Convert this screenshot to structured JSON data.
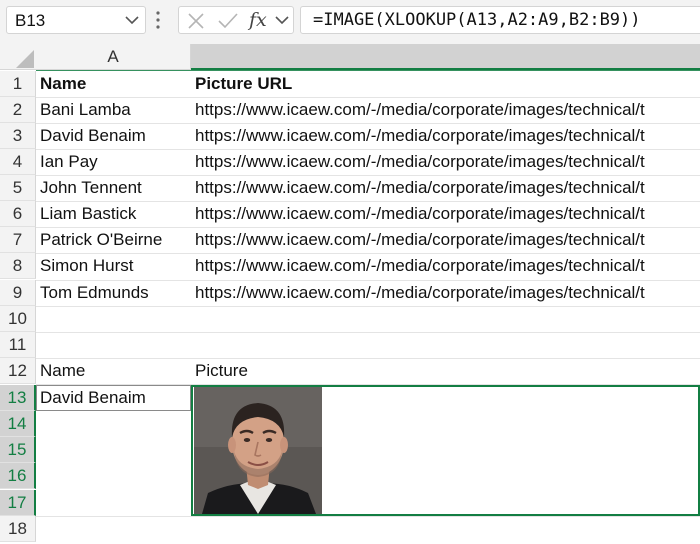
{
  "formula_bar": {
    "name_box": "B13",
    "fx_label": "fx",
    "formula": "=IMAGE(XLOOKUP(A13,A2:A9,B2:B9))"
  },
  "columns": [
    "A",
    ""
  ],
  "rows": [
    {
      "num": "1",
      "a": "Name",
      "b": "Picture URL"
    },
    {
      "num": "2",
      "a": "Bani Lamba",
      "b": "https://www.icaew.com/-/media/corporate/images/technical/t"
    },
    {
      "num": "3",
      "a": "David Benaim",
      "b": "https://www.icaew.com/-/media/corporate/images/technical/t"
    },
    {
      "num": "4",
      "a": "Ian Pay",
      "b": "https://www.icaew.com/-/media/corporate/images/technical/t"
    },
    {
      "num": "5",
      "a": "John Tennent",
      "b": "https://www.icaew.com/-/media/corporate/images/technical/t"
    },
    {
      "num": "6",
      "a": "Liam Bastick",
      "b": "https://www.icaew.com/-/media/corporate/images/technical/t"
    },
    {
      "num": "7",
      "a": "Patrick O'Beirne",
      "b": "https://www.icaew.com/-/media/corporate/images/technical/t"
    },
    {
      "num": "8",
      "a": "Simon Hurst",
      "b": "https://www.icaew.com/-/media/corporate/images/technical/t"
    },
    {
      "num": "9",
      "a": "Tom Edmunds",
      "b": "https://www.icaew.com/-/media/corporate/images/technical/t"
    },
    {
      "num": "10",
      "a": "",
      "b": ""
    },
    {
      "num": "11",
      "a": "",
      "b": ""
    },
    {
      "num": "12",
      "a": "Name",
      "b": "Picture"
    },
    {
      "num": "13",
      "a": "David Benaim",
      "b": ""
    },
    {
      "num": "14",
      "a": "",
      "b": ""
    },
    {
      "num": "15",
      "a": "",
      "b": ""
    },
    {
      "num": "16",
      "a": "",
      "b": ""
    },
    {
      "num": "17",
      "a": "",
      "b": ""
    },
    {
      "num": "18",
      "a": "",
      "b": ""
    }
  ],
  "icons": {
    "name_box_dropdown": "chevron-down-icon",
    "separator": "vertical-dots-icon",
    "cancel": "close-icon",
    "enter": "checkmark-icon",
    "function_dropdown": "chevron-down-icon",
    "select_all": "select-all-triangle-icon",
    "picture": "portrait-photo"
  },
  "colors": {
    "selection": "#137e43",
    "header_bg": "#f3f3f3",
    "selected_header_bg": "#d2d2d2"
  }
}
